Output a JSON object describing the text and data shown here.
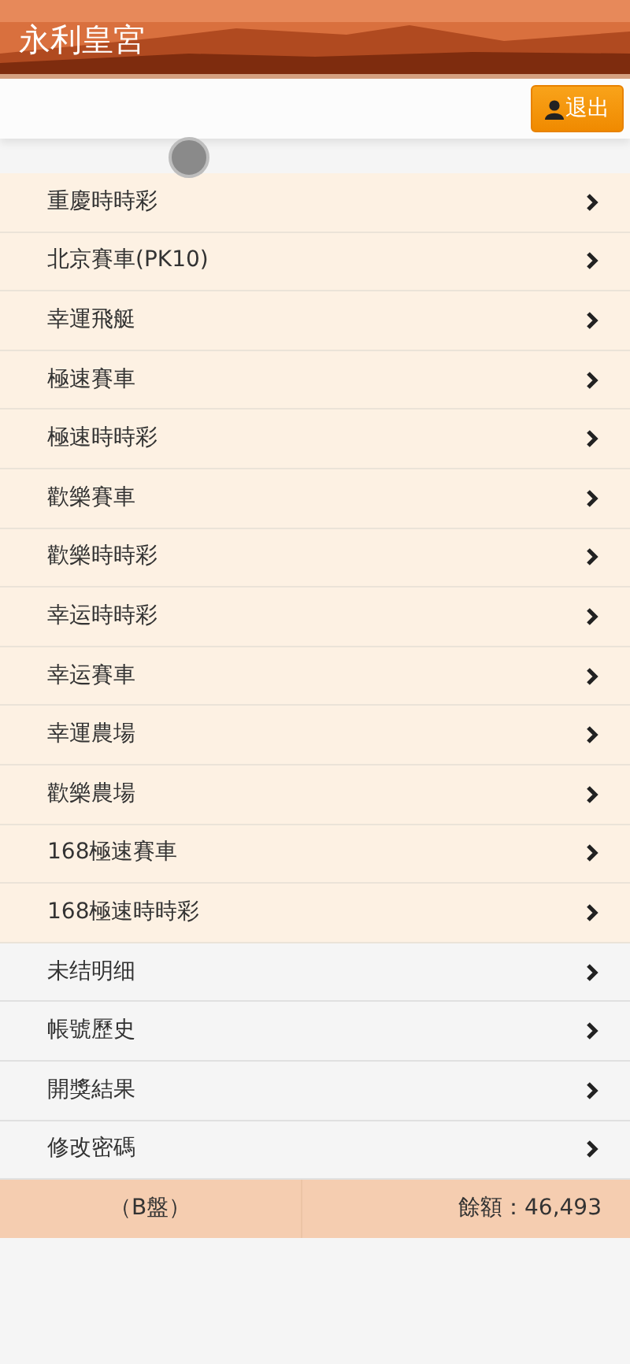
{
  "header": {
    "title": "永利皇宮"
  },
  "toolbar": {
    "logout_button": "退出"
  },
  "menu": [
    {
      "label": "重慶時時彩",
      "kind": "game"
    },
    {
      "label": "北京賽車(PK10)",
      "kind": "game"
    },
    {
      "label": "幸運飛艇",
      "kind": "game"
    },
    {
      "label": "極速賽車",
      "kind": "game"
    },
    {
      "label": "極速時時彩",
      "kind": "game"
    },
    {
      "label": "歡樂賽車",
      "kind": "game"
    },
    {
      "label": "歡樂時時彩",
      "kind": "game"
    },
    {
      "label": "幸运時時彩",
      "kind": "game"
    },
    {
      "label": "幸运賽車",
      "kind": "game"
    },
    {
      "label": "幸運農場",
      "kind": "game"
    },
    {
      "label": "歡樂農場",
      "kind": "game"
    },
    {
      "label": "168極速賽車",
      "kind": "game"
    },
    {
      "label": "168極速時時彩",
      "kind": "game"
    },
    {
      "label": "未结明细",
      "kind": "account"
    },
    {
      "label": "帳號歷史",
      "kind": "account"
    },
    {
      "label": "開獎結果",
      "kind": "account"
    },
    {
      "label": "修改密碼",
      "kind": "account"
    }
  ],
  "footer": {
    "plate": "（B盤）",
    "balance": "餘額：46,493"
  }
}
